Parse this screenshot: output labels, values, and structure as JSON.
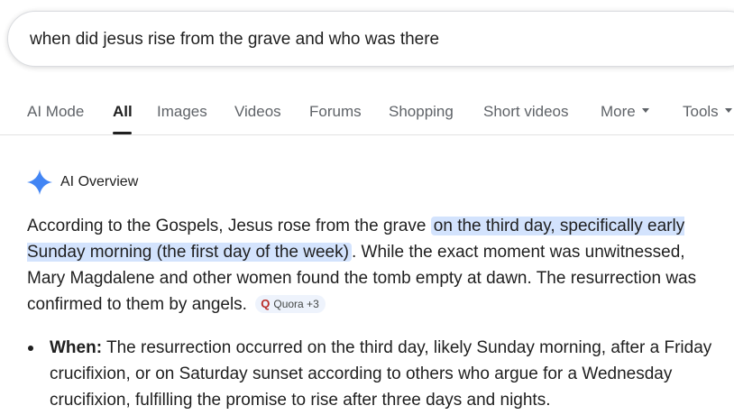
{
  "search": {
    "query": "when did jesus rise from the grave and who was there"
  },
  "tabs": [
    {
      "label": "AI Mode"
    },
    {
      "label": "All"
    },
    {
      "label": "Images"
    },
    {
      "label": "Videos"
    },
    {
      "label": "Forums"
    },
    {
      "label": "Shopping"
    },
    {
      "label": "Short videos"
    },
    {
      "label": "More"
    },
    {
      "label": "Tools"
    }
  ],
  "overview": {
    "title": "AI Overview",
    "para_before": "According to the Gospels, Jesus rose from the grave",
    "para_highlight": "on the third day, specifically early Sunday morning (the first day of the week)",
    "para_after": ". While the exact moment was unwitnessed, Mary Magdalene and other women found the tomb empty at dawn. The resurrection was confirmed to them by angels.",
    "source_chip": "Quora +3",
    "bullets": [
      {
        "heading": "When:",
        "text": " The resurrection occurred on the third day, likely Sunday morning, after a Friday crucifixion, or on Saturday sunset according to others who argue for a Wednesday crucifixion, fulfilling the promise to rise after three days and nights."
      }
    ]
  },
  "colors": {
    "highlight": "#d3e3fd",
    "spark": "#4285f4",
    "quora": "#b92b27"
  }
}
